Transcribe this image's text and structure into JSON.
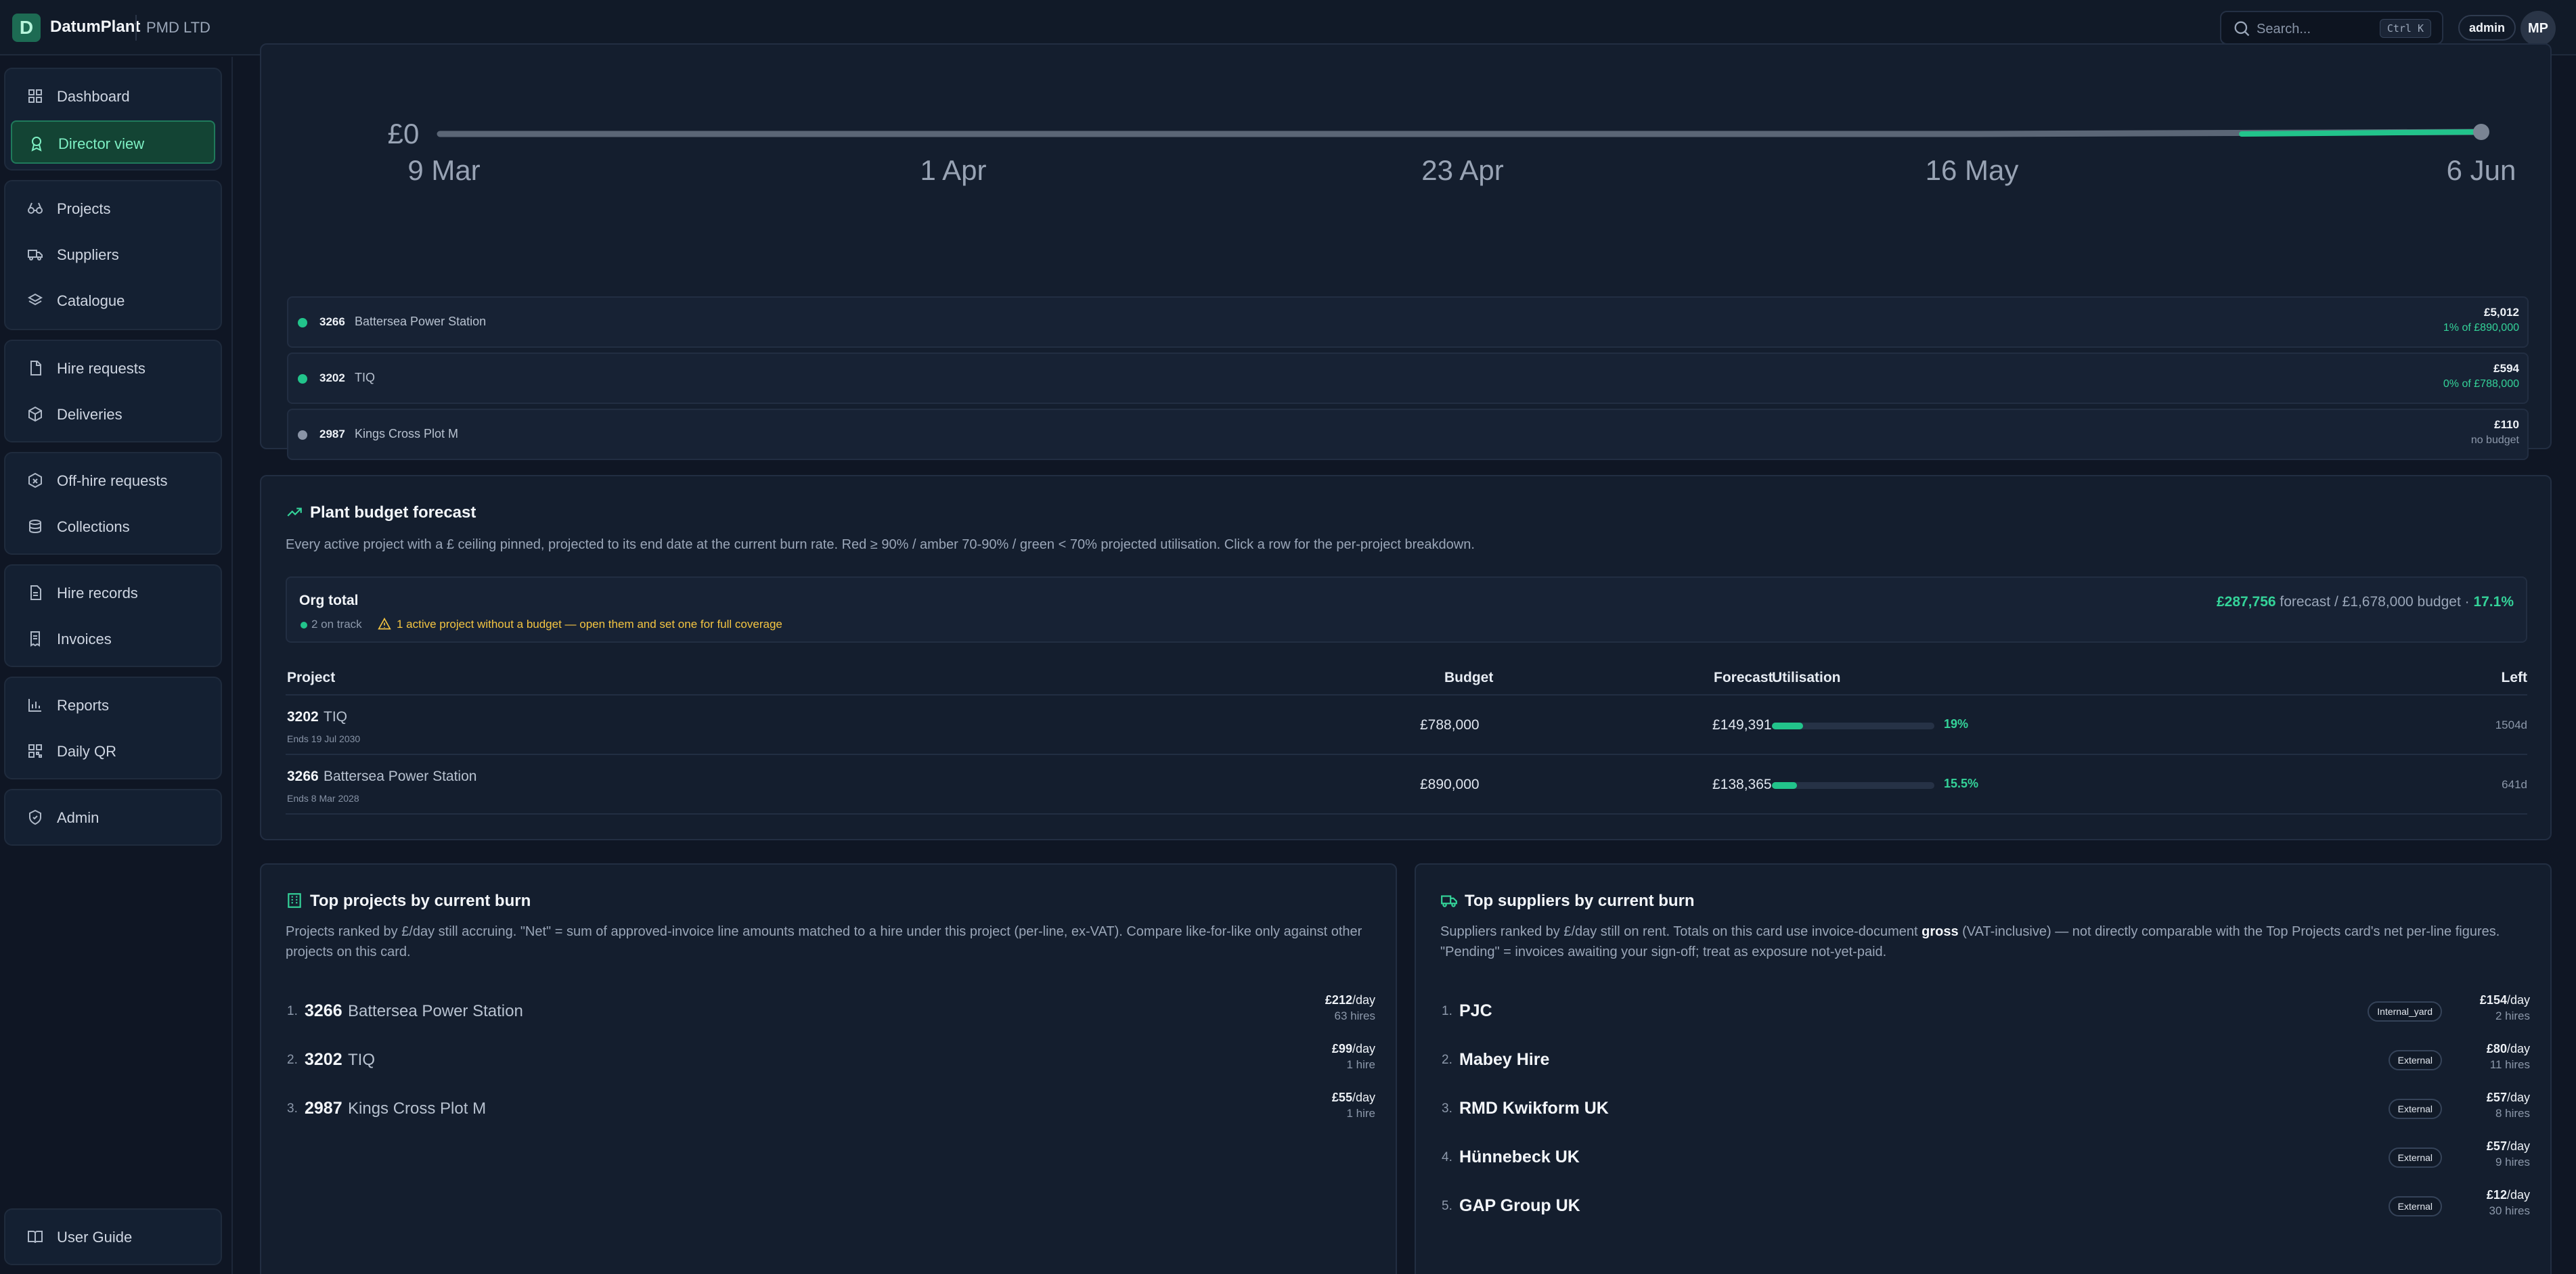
{
  "topbar": {
    "logo_letter": "D",
    "brand": "DatumPlant",
    "org": "PMD LTD",
    "search_placeholder": "Search...",
    "search_shortcut": "Ctrl K",
    "role": "admin",
    "avatar": "MP"
  },
  "sidebar": {
    "groups": [
      [
        {
          "label": "Dashboard",
          "icon": "grid-icon"
        },
        {
          "label": "Director view",
          "icon": "badge-icon",
          "active": true
        }
      ],
      [
        {
          "label": "Projects",
          "icon": "binoculars-icon"
        },
        {
          "label": "Suppliers",
          "icon": "truck-icon"
        },
        {
          "label": "Catalogue",
          "icon": "layers-icon"
        }
      ],
      [
        {
          "label": "Hire requests",
          "icon": "file-icon"
        },
        {
          "label": "Deliveries",
          "icon": "package-icon"
        }
      ],
      [
        {
          "label": "Off-hire requests",
          "icon": "package-x-icon"
        },
        {
          "label": "Collections",
          "icon": "stack-icon"
        }
      ],
      [
        {
          "label": "Hire records",
          "icon": "file-text-icon"
        },
        {
          "label": "Invoices",
          "icon": "invoice-icon"
        }
      ],
      [
        {
          "label": "Reports",
          "icon": "bar-chart-icon"
        },
        {
          "label": "Daily QR",
          "icon": "qr-icon"
        }
      ],
      [
        {
          "label": "Admin",
          "icon": "shield-icon"
        }
      ]
    ],
    "footer": {
      "label": "User Guide",
      "icon": "book-icon"
    }
  },
  "chart_data": {
    "type": "line",
    "x": [
      "9 Mar",
      "1 Apr",
      "23 Apr",
      "16 May",
      "6 Jun"
    ],
    "ytick_visible": "£0",
    "series": [
      {
        "values": [
          0,
          0,
          0,
          0,
          0.3
        ]
      }
    ],
    "line_color": "#22c48b"
  },
  "spend_rows": [
    {
      "code": "3266",
      "name": "Battersea Power Station",
      "amount": "£5,012",
      "sub": "1% of £890,000",
      "status_color": "#22c48b",
      "sub_color": "#34d399"
    },
    {
      "code": "3202",
      "name": "TIQ",
      "amount": "£594",
      "sub": "0% of £788,000",
      "status_color": "#22c48b",
      "sub_color": "#34d399"
    },
    {
      "code": "2987",
      "name": "Kings Cross Plot M",
      "amount": "£110",
      "sub": "no budget",
      "status_color": "#8a94a6",
      "sub_color": "#8c98aa"
    }
  ],
  "forecast": {
    "title": "Plant budget forecast",
    "description": "Every active project with a £ ceiling pinned, projected to its end date at the current burn rate. Red ≥ 90% / amber 70-90% / green < 70% projected utilisation. Click a row for the per-project breakdown.",
    "org_total_label": "Org total",
    "on_track": "2 on track",
    "warning": "1 active project without a budget — open them and set one for full coverage",
    "forecast_amount": "£287,756",
    "forecast_rest": "forecast / £1,678,000 budget ·",
    "forecast_pct": "17.1%",
    "headers": {
      "project": "Project",
      "budget": "Budget",
      "forecast": "Forecast",
      "utilisation": "Utilisation",
      "left": "Left"
    },
    "rows": [
      {
        "code": "3202",
        "name": "TIQ",
        "ends": "Ends 19 Jul 2030",
        "budget": "£788,000",
        "forecast": "£149,391",
        "util": 0.19,
        "util_label": "19%",
        "left": "1504d"
      },
      {
        "code": "3266",
        "name": "Battersea Power Station",
        "ends": "Ends 8 Mar 2028",
        "budget": "£890,000",
        "forecast": "£138,365",
        "util": 0.155,
        "util_label": "15.5%",
        "left": "641d"
      }
    ]
  },
  "top_projects": {
    "title": "Top projects by current burn",
    "description": "Projects ranked by £/day still accruing. \"Net\" = sum of approved-invoice line amounts matched to a hire under this project (per-line, ex-VAT). Compare like-for-like only against other projects on this card.",
    "items": [
      {
        "rank": "1.",
        "code": "3266",
        "name": "Battersea Power Station",
        "rate": "£212",
        "unit": "/day",
        "hires": "63 hires"
      },
      {
        "rank": "2.",
        "code": "3202",
        "name": "TIQ",
        "rate": "£99",
        "unit": "/day",
        "hires": "1 hire"
      },
      {
        "rank": "3.",
        "code": "2987",
        "name": "Kings Cross Plot M",
        "rate": "£55",
        "unit": "/day",
        "hires": "1 hire"
      }
    ]
  },
  "top_suppliers": {
    "title": "Top suppliers by current burn",
    "desc_a": "Suppliers ranked by £/day still on rent. Totals on this card use invoice-document ",
    "desc_bold": "gross",
    "desc_b": " (VAT-inclusive) — not directly comparable with the Top Projects card's net per-line figures. \"Pending\" = invoices awaiting your sign-off; treat as exposure not-yet-paid.",
    "items": [
      {
        "rank": "1.",
        "name": "PJC",
        "tag": "Internal_yard",
        "rate": "£154",
        "unit": "/day",
        "hires": "2 hires"
      },
      {
        "rank": "2.",
        "name": "Mabey Hire",
        "tag": "External",
        "rate": "£80",
        "unit": "/day",
        "hires": "11 hires"
      },
      {
        "rank": "3.",
        "name": "RMD Kwikform UK",
        "tag": "External",
        "rate": "£57",
        "unit": "/day",
        "hires": "8 hires"
      },
      {
        "rank": "4.",
        "name": "Hünnebeck UK",
        "tag": "External",
        "rate": "£57",
        "unit": "/day",
        "hires": "9 hires"
      },
      {
        "rank": "5.",
        "name": "GAP Group UK",
        "tag": "External",
        "rate": "£12",
        "unit": "/day",
        "hires": "30 hires"
      }
    ]
  }
}
